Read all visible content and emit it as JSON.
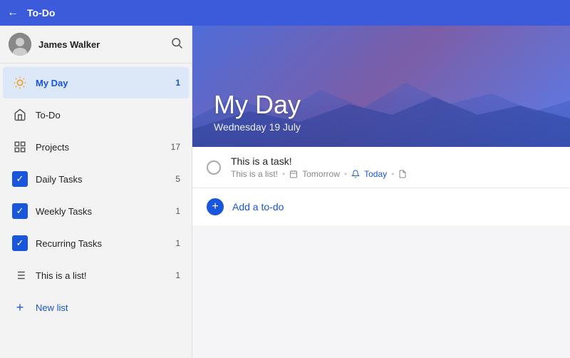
{
  "topbar": {
    "title": "To-Do",
    "back_icon": "←"
  },
  "sidebar": {
    "user": {
      "name": "James Walker"
    },
    "search_icon": "🔍",
    "nav_items": [
      {
        "id": "my-day",
        "label": "My Day",
        "count": 1,
        "active": true,
        "icon": "sun"
      },
      {
        "id": "todo",
        "label": "To-Do",
        "count": null,
        "active": false,
        "icon": "home"
      },
      {
        "id": "projects",
        "label": "Projects",
        "count": 17,
        "active": false,
        "icon": "grid"
      },
      {
        "id": "daily-tasks",
        "label": "Daily Tasks",
        "count": 5,
        "active": false,
        "icon": "check"
      },
      {
        "id": "weekly-tasks",
        "label": "Weekly Tasks",
        "count": 1,
        "active": false,
        "icon": "check"
      },
      {
        "id": "recurring-tasks",
        "label": "Recurring Tasks",
        "count": 1,
        "active": false,
        "icon": "check"
      },
      {
        "id": "this-is-a-list",
        "label": "This is a list!",
        "count": 1,
        "active": false,
        "icon": "list"
      }
    ],
    "new_list_label": "New list"
  },
  "content": {
    "title": "My Day",
    "subtitle": "Wednesday 19 July",
    "tasks": [
      {
        "id": "task1",
        "name": "This is a task!",
        "list": "This is a list!",
        "due": "Tomorrow",
        "reminder": "Today",
        "has_note": true
      }
    ],
    "add_todo_label": "Add a to-do"
  }
}
